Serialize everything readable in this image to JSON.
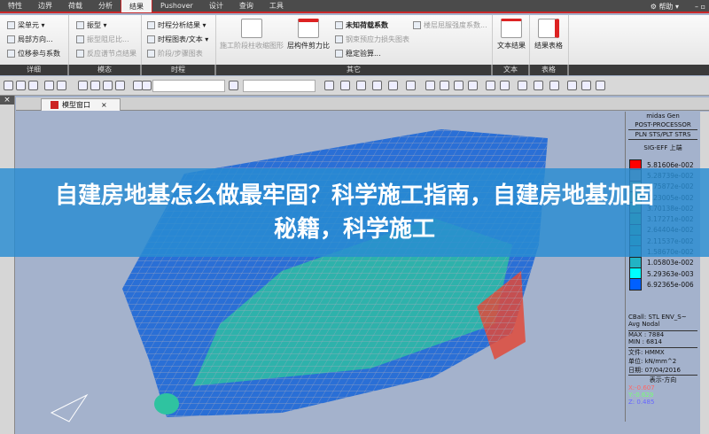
{
  "menu_tabs": [
    "特性",
    "边界",
    "荷载",
    "分析",
    "结果",
    "Pushover",
    "设计",
    "查询",
    "工具"
  ],
  "active_tab": "结果",
  "help_label": "帮助",
  "ribbon": {
    "detail": {
      "items": [
        "梁单元 ▾",
        "局部方向...",
        "位移参与系数"
      ],
      "label": "详细"
    },
    "modal": {
      "items": [
        "振型 ▾",
        "振型阻尼比...",
        "反应谱节点结果"
      ],
      "label": "模态"
    },
    "history": {
      "items": [
        "时程分析结果 ▾",
        "时程图表/文本 ▾",
        "阶段/步骤图表"
      ],
      "label": "时程"
    },
    "other": {
      "big": [
        "施工阶段柱收缩图形",
        "层构件剪力比"
      ],
      "items": [
        "未知荷载系数",
        "钢束预应力损失图表",
        "稳定验算...",
        "楼层屈服强度系数..."
      ],
      "label": "其它"
    },
    "text": {
      "big": "文本结果",
      "label": "文本"
    },
    "table": {
      "big": "结果表格",
      "label": "表格"
    }
  },
  "doc_tab": "模型窗口",
  "legend": {
    "header1": "midas Gen",
    "header2": "POST-PROCESSOR",
    "header3": "PLN STS/PLT STRS",
    "component": "SIG-EFF 上端",
    "values": [
      "5.81606e-002",
      "5.28739e-002",
      "4.75872e-002",
      "4.23005e-002",
      "3.70138e-002",
      "3.17271e-002",
      "2.64404e-002",
      "2.11537e-002",
      "1.58670e-002",
      "1.05803e-002",
      "5.29363e-003",
      "6.92365e-006"
    ],
    "colors": [
      "#ff0000",
      "#8f8f8f",
      "#6fb07a",
      "#5caf6a",
      "#4cab6d",
      "#3aa975",
      "#2aa883",
      "#20a694",
      "#1ea8a8",
      "#22b3c4",
      "#00ffff",
      "#0060ff"
    ],
    "cball": "CBall: STL ENV_S~",
    "avg": "Avg Nodal",
    "max": "MAX : 7884",
    "min": "MIN : 6814",
    "file": "文件: HMMX",
    "unit": "单位: kN/mm^2",
    "date": "日期: 07/04/2016",
    "view": "表示-方向",
    "x": "X:-0.607",
    "y": "Y:-0.629",
    "z": "Z: 0.485"
  },
  "banner_title": "自建房地基怎么做最牢固？科学施工指南，自建房地基加固秘籍，科学施工"
}
